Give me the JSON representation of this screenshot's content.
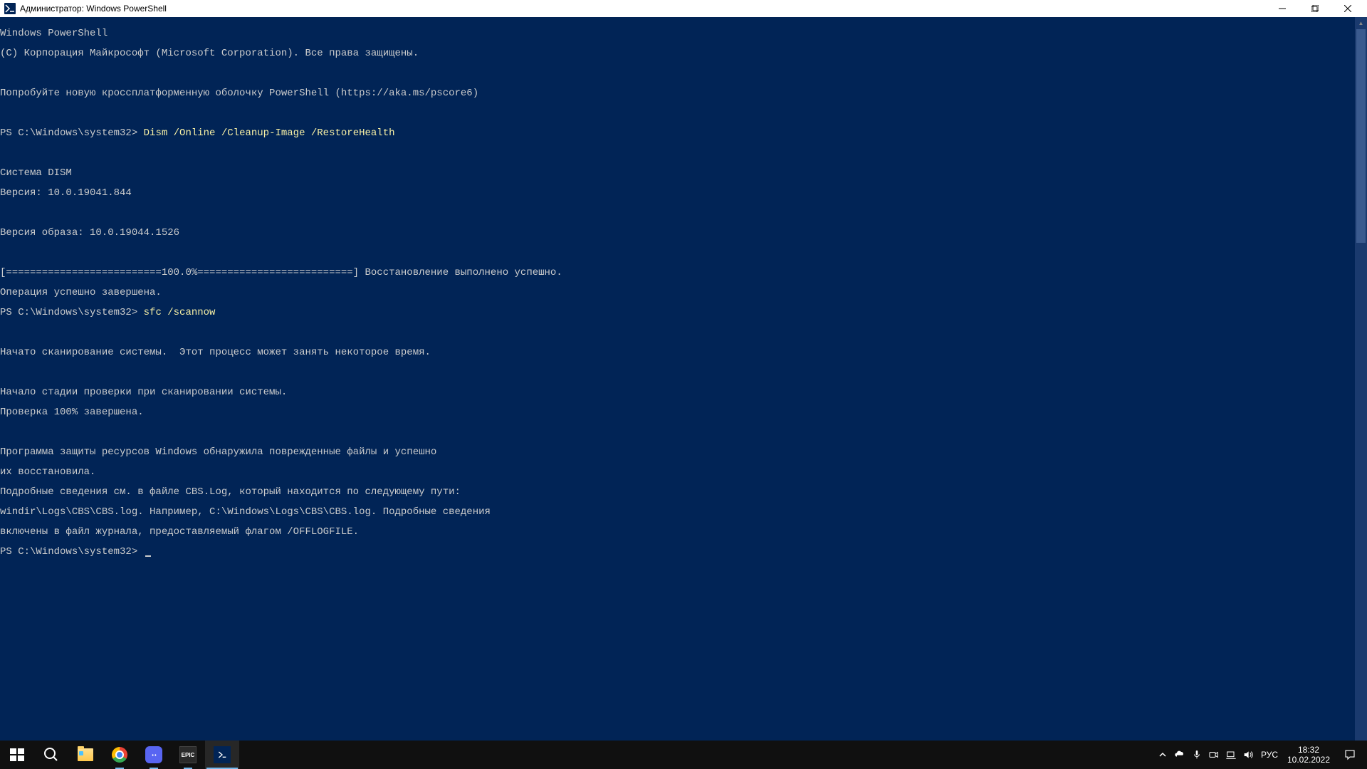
{
  "window": {
    "title": "Администратор: Windows PowerShell"
  },
  "terminal": {
    "lines": [
      "Windows PowerShell",
      "(C) Корпорация Майкрософт (Microsoft Corporation). Все права защищены.",
      "",
      "Попробуйте новую кроссплатформенную оболочку PowerShell (https://aka.ms/pscore6)",
      ""
    ],
    "prompt1_prefix": "PS C:\\Windows\\system32> ",
    "prompt1_cmd": "Dism /Online /Cleanup-Image /RestoreHealth",
    "block2": [
      "",
      "Cистема DISM",
      "Версия: 10.0.19041.844",
      "",
      "Версия образа: 10.0.19044.1526",
      "",
      "[==========================100.0%==========================] Восстановление выполнено успешно.",
      "Операция успешно завершена."
    ],
    "prompt2_prefix": "PS C:\\Windows\\system32> ",
    "prompt2_cmd": "sfc /scannow",
    "block3": [
      "",
      "Начато сканирование системы.  Этот процесс может занять некоторое время.",
      "",
      "Начало стадии проверки при сканировании системы.",
      "Проверка 100% завершена.",
      "",
      "Программа защиты ресурсов Windows обнаружила поврежденные файлы и успешно",
      "их восстановила.",
      "Подробные сведения см. в файле CBS.Log, который находится по следующему пути:",
      "windir\\Logs\\CBS\\CBS.log. Например, C:\\Windows\\Logs\\CBS\\CBS.log. Подробные сведения",
      "включены в файл журнала, предоставляемый флагом /OFFLOGFILE."
    ],
    "prompt3": "PS C:\\Windows\\system32> "
  },
  "taskbar": {
    "lang": "РУС",
    "time": "18:32",
    "date": "10.02.2022",
    "epic_label": "EPIC"
  }
}
